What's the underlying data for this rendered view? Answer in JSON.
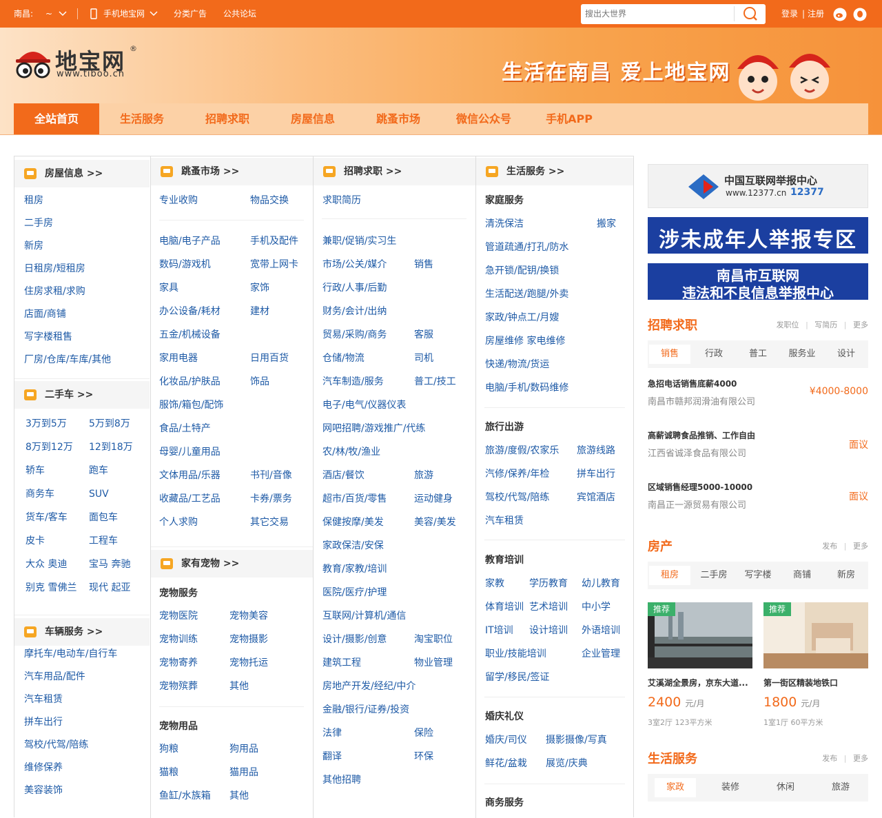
{
  "topbar": {
    "city": "南昌:",
    "city_switch": "~",
    "mobile": "手机地宝网",
    "classified": "分类广告",
    "forum": "公共论坛",
    "search_placeholder": "搜出大世界",
    "login": "登录",
    "divider": "|",
    "register": "注册"
  },
  "header": {
    "logo_text": "地宝网",
    "logo_reg": "®",
    "logo_url": "www.tiboo.cn",
    "slogan": "生活在南昌 爱上地宝网"
  },
  "nav": [
    "全站首页",
    "生活服务",
    "招聘求职",
    "房屋信息",
    "跳蚤市场",
    "微信公众号",
    "手机APP"
  ],
  "cats": {
    "house": {
      "title": "房屋信息 >>",
      "items": [
        "租房",
        "二手房",
        "新房",
        "日租房/短租房",
        "住房求租/求购",
        "店面/商铺",
        "写字楼租售",
        "厂房/仓库/车库/其他"
      ]
    },
    "car": {
      "title": "二手车 >>",
      "rows": [
        [
          "3万到5万",
          "5万到8万"
        ],
        [
          "8万到12万",
          "12到18万"
        ],
        [
          "轿车",
          "跑车"
        ],
        [
          "商务车",
          "SUV"
        ],
        [
          "货车/客车",
          "面包车"
        ],
        [
          "皮卡",
          "工程车"
        ],
        [
          "大众 奥迪",
          "宝马 奔驰"
        ],
        [
          "别克 雪佛兰",
          "现代 起亚"
        ]
      ]
    },
    "vehicle": {
      "title": "车辆服务 >>",
      "items": [
        "摩托车/电动车/自行车",
        "汽车用品/配件",
        "汽车租赁",
        "拼车出行",
        "驾校/代驾/陪练",
        "维修保养",
        "美容装饰"
      ]
    },
    "flea": {
      "title": "跳蚤市场 >>",
      "top": [
        [
          "专业收购",
          "物品交换"
        ]
      ],
      "rows": [
        [
          "电脑/电子产品",
          "手机及配件"
        ],
        [
          "数码/游戏机",
          "宽带上网卡"
        ],
        [
          "家具",
          "家饰"
        ],
        [
          "办公设备/耗材",
          "建材"
        ],
        [
          "五金/机械设备",
          ""
        ],
        [
          "家用电器",
          "日用百货"
        ],
        [
          "化妆品/护肤品",
          "饰品"
        ],
        [
          "服饰/箱包/配饰",
          ""
        ],
        [
          "食品/土特产",
          ""
        ],
        [
          "母婴/儿童用品",
          ""
        ],
        [
          "文体用品/乐器",
          "书刊/音像"
        ],
        [
          "收藏品/工艺品",
          "卡券/票务"
        ],
        [
          "个人求购",
          "其它交易"
        ]
      ]
    },
    "pet": {
      "title": "家有宠物 >>",
      "svc_title": "宠物服务",
      "svc": [
        [
          "宠物医院",
          "宠物美容"
        ],
        [
          "宠物训练",
          "宠物摄影"
        ],
        [
          "宠物寄养",
          "宠物托运"
        ],
        [
          "宠物殡葬",
          "其他"
        ]
      ],
      "goods_title": "宠物用品",
      "goods": [
        [
          "狗粮",
          "狗用品"
        ],
        [
          "猫粮",
          "猫用品"
        ],
        [
          "鱼缸/水族箱",
          "其他"
        ]
      ]
    },
    "job": {
      "title": "招聘求职 >>",
      "top": "求职简历",
      "rows": [
        [
          "兼职/促销/实习生",
          ""
        ],
        [
          "市场/公关/媒介",
          "销售"
        ],
        [
          "行政/人事/后勤",
          ""
        ],
        [
          "财务/会计/出纳",
          ""
        ],
        [
          "贸易/采购/商务",
          "客服"
        ],
        [
          "仓储/物流",
          "司机"
        ],
        [
          "汽车制造/服务",
          "普工/技工"
        ],
        [
          "电子/电气/仪器仪表",
          ""
        ],
        [
          "网吧招聘/游戏推广/代练",
          ""
        ],
        [
          "农/林/牧/渔业",
          ""
        ],
        [
          "酒店/餐饮",
          "旅游"
        ],
        [
          "超市/百货/零售",
          "运动健身"
        ],
        [
          "保健按摩/美发",
          "美容/美发"
        ],
        [
          "家政保洁/安保",
          ""
        ],
        [
          "教育/家教/培训",
          ""
        ],
        [
          "医院/医疗/护理",
          ""
        ],
        [
          "互联网/计算机/通信",
          ""
        ],
        [
          "设计/摄影/创意",
          "淘宝职位"
        ],
        [
          "建筑工程",
          "物业管理"
        ],
        [
          "房地产开发/经纪/中介",
          ""
        ],
        [
          "金融/银行/证券/投资",
          ""
        ],
        [
          "法律",
          "保险"
        ],
        [
          "翻译",
          "环保"
        ],
        [
          "其他招聘",
          ""
        ]
      ]
    },
    "life": {
      "title": "生活服务 >>",
      "home_title": "家庭服务",
      "home": [
        [
          "清洗保洁",
          "搬家"
        ],
        [
          "管道疏通/打孔/防水",
          ""
        ],
        [
          "急开锁/配钥/换锁",
          ""
        ],
        [
          "生活配送/跑腿/外卖",
          ""
        ],
        [
          "家政/钟点工/月嫂",
          ""
        ],
        [
          "房屋维修 家电维修",
          ""
        ],
        [
          "快递/物流/货运",
          ""
        ],
        [
          "电脑/手机/数码维修",
          ""
        ]
      ],
      "travel_title": "旅行出游",
      "travel": [
        [
          "旅游/度假/农家乐",
          "旅游线路"
        ],
        [
          "汽修/保养/年检",
          "拼车出行"
        ],
        [
          "驾校/代驾/陪练",
          "宾馆酒店"
        ],
        [
          "汽车租赁",
          ""
        ]
      ],
      "edu_title": "教育培训",
      "edu": [
        [
          "家教",
          "学历教育",
          "幼儿教育"
        ],
        [
          "体育培训",
          "艺术培训",
          "中小学"
        ],
        [
          "IT培训",
          "设计培训",
          "外语培训"
        ],
        [
          "职业/技能培训",
          "",
          "企业管理"
        ],
        [
          "留学/移民/签证",
          "",
          ""
        ]
      ],
      "wed_title": "婚庆礼仪",
      "wed": [
        [
          "婚庆/司仪",
          "摄影摄像/写真"
        ],
        [
          "鲜花/盆栽",
          "展览/庆典"
        ]
      ],
      "biz_title": "商务服务"
    }
  },
  "right": {
    "banner1_title": "中国互联网举报中心",
    "banner1_url": "www.12377.cn",
    "banner1_phone": "12377",
    "banner2": "涉未成年人举报专区",
    "banner3_l1": "南昌市互联网",
    "banner3_l2": "违法和不良信息举报中心",
    "jobs": {
      "title": "招聘求职",
      "links": [
        "发职位",
        "写简历",
        "更多"
      ],
      "tabs": [
        "销售",
        "行政",
        "普工",
        "服务业",
        "设计"
      ],
      "list": [
        {
          "t": "急招电话销售底薪4000",
          "c": "南昌市赣邦润滑油有限公司",
          "p": "¥4000-8000"
        },
        {
          "t": "高薪诚聘食品推销、工作自由",
          "c": "江西省诚泽食品有限公司",
          "p": "面议"
        },
        {
          "t": "区域销售经理5000-10000",
          "c": "南昌正一源贸易有限公司",
          "p": "面议"
        }
      ]
    },
    "house": {
      "title": "房产",
      "links": [
        "发布",
        "更多"
      ],
      "tabs": [
        "租房",
        "二手房",
        "写字楼",
        "商铺",
        "新房"
      ],
      "list": [
        {
          "rec": "推荐",
          "t": "艾溪湖全景房，京东大道...",
          "p": "2400",
          "u": "元/月",
          "d": "3室2厅 123平方米"
        },
        {
          "rec": "推荐",
          "t": "第一街区精装地铁口",
          "p": "1800",
          "u": "元/月",
          "d": "1室1厅 60平方米"
        }
      ]
    },
    "life": {
      "title": "生活服务",
      "links": [
        "发布",
        "更多"
      ],
      "tabs": [
        "家政",
        "装修",
        "休闲",
        "旅游"
      ]
    }
  },
  "colors": {
    "brand": "#f26a1b",
    "link": "#1e5aa6"
  }
}
